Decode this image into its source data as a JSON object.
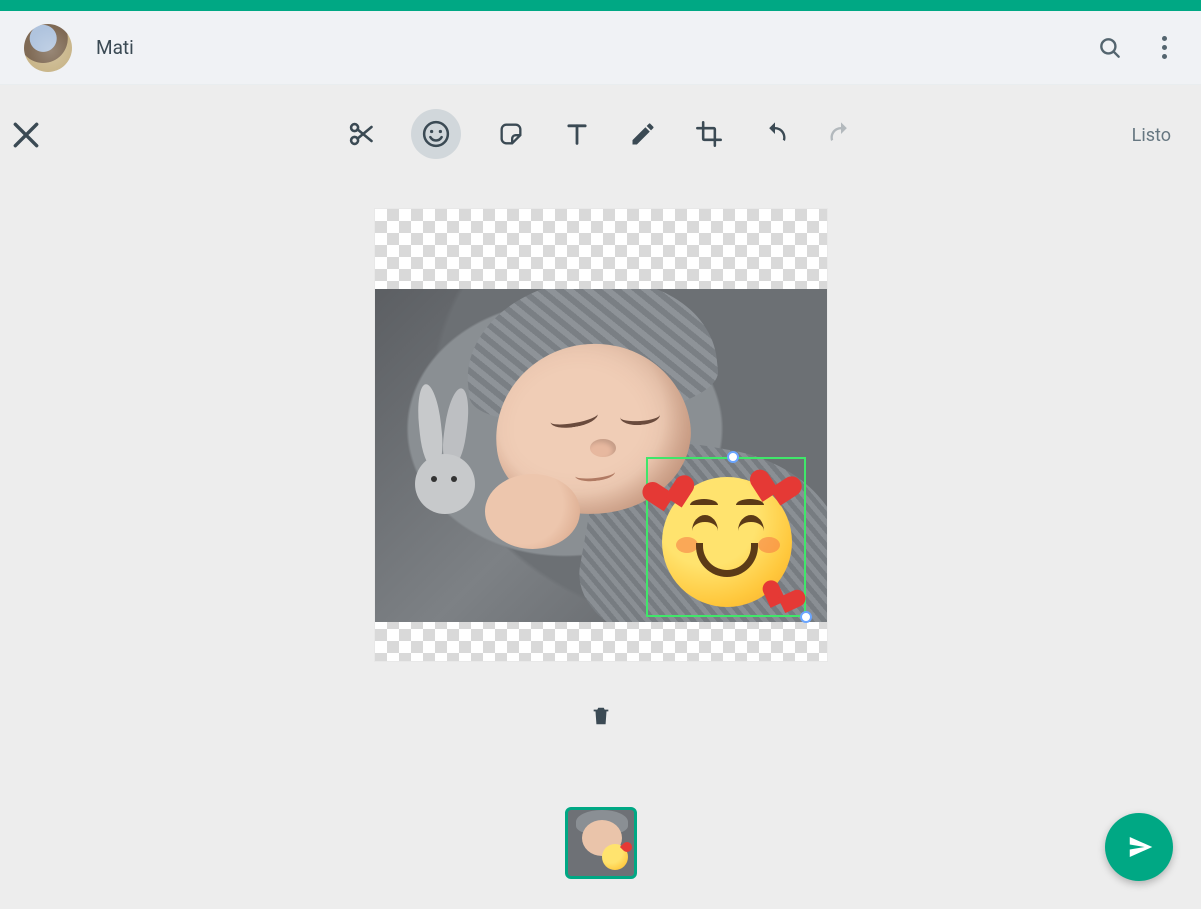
{
  "colors": {
    "accent": "#00a884",
    "selection": "#40e66a"
  },
  "header": {
    "chat_name": "Mati",
    "icons": {
      "search": "search-icon",
      "menu": "menu-dots-icon"
    }
  },
  "editor": {
    "close": "close-icon",
    "ready_label": "Listo",
    "tools": [
      {
        "id": "cut",
        "icon": "scissors-icon",
        "active": false,
        "enabled": true
      },
      {
        "id": "emoji",
        "icon": "emoji-icon",
        "active": true,
        "enabled": true
      },
      {
        "id": "sticker",
        "icon": "sticker-icon",
        "active": false,
        "enabled": true
      },
      {
        "id": "text",
        "icon": "text-icon",
        "active": false,
        "enabled": true
      },
      {
        "id": "draw",
        "icon": "pencil-icon",
        "active": false,
        "enabled": true
      },
      {
        "id": "crop",
        "icon": "crop-icon",
        "active": false,
        "enabled": true
      },
      {
        "id": "undo",
        "icon": "undo-icon",
        "active": false,
        "enabled": true
      },
      {
        "id": "redo",
        "icon": "redo-icon",
        "active": false,
        "enabled": false
      }
    ],
    "canvas": {
      "image_description": "sleeping baby in gray knit hat with plush bunny",
      "overlay": {
        "type": "emoji",
        "name": "smiling-face-with-hearts",
        "selected": true
      }
    },
    "trash": "trash-icon",
    "thumbnails": [
      {
        "selected": true
      }
    ],
    "send": "send-icon"
  }
}
